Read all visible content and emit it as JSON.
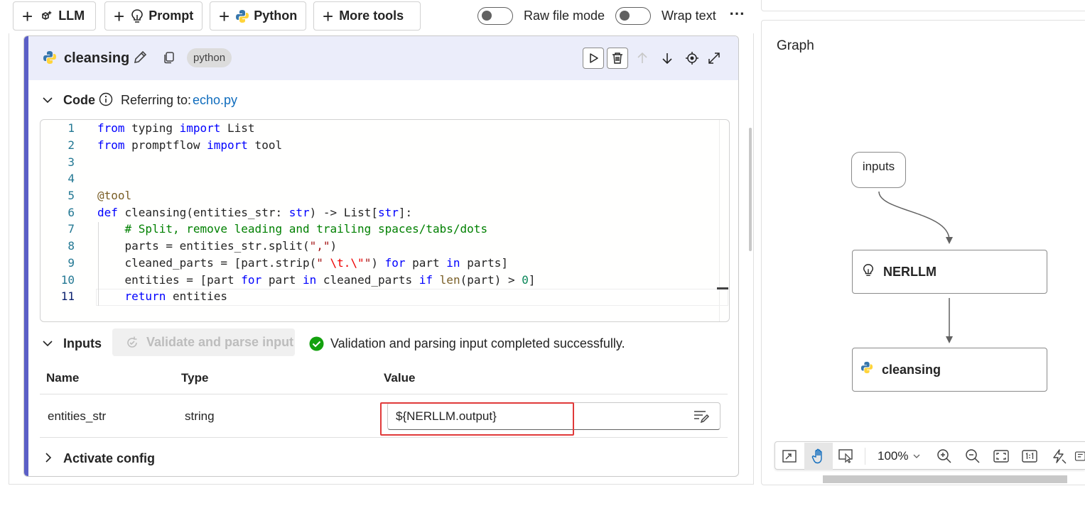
{
  "toolbar": {
    "llm_label": "LLM",
    "prompt_label": "Prompt",
    "python_label": "Python",
    "more_tools_label": "More tools",
    "raw_file_mode_label": "Raw file mode",
    "wrap_text_label": "Wrap text",
    "more_icon": "ellipsis-icon"
  },
  "node": {
    "name": "cleansing",
    "type_badge": "python",
    "actions": [
      "run-icon",
      "delete-icon",
      "arrow-up-icon",
      "arrow-down-icon",
      "locate-icon",
      "expand-icon"
    ]
  },
  "code_section": {
    "title": "Code",
    "referring_label": "Referring to:",
    "file_link": "echo.py",
    "lines": [
      {
        "n": "1"
      },
      {
        "n": "2"
      },
      {
        "n": "3"
      },
      {
        "n": "4"
      },
      {
        "n": "5"
      },
      {
        "n": "6"
      },
      {
        "n": "7"
      },
      {
        "n": "8"
      },
      {
        "n": "9"
      },
      {
        "n": "10"
      },
      {
        "n": "11"
      }
    ],
    "tokens": {
      "l1": [
        "from",
        " typing ",
        "import",
        " List"
      ],
      "l2": [
        "from",
        " promptflow ",
        "import",
        " tool"
      ],
      "l5": [
        "@tool"
      ],
      "l6": [
        "def",
        " cleansing(entities_str: ",
        "str",
        ") -> List[",
        "str",
        "]:"
      ],
      "l7": [
        "    ",
        "# Split, remove leading and trailing spaces/tabs/dots"
      ],
      "l8": [
        "    parts = entities_str.split(",
        "\",\"",
        ")"
      ],
      "l9": [
        "    cleaned_parts = [part.strip(",
        "\" ",
        "\\t.\\\"",
        "\"",
        ") ",
        "for",
        " part ",
        "in",
        " parts]"
      ],
      "l10": [
        "    entities = [part ",
        "for",
        " part ",
        "in",
        " cleaned_parts ",
        "if",
        " ",
        "len",
        "(part) > ",
        "0",
        "]"
      ],
      "l11": [
        "    ",
        "return",
        " entities"
      ]
    }
  },
  "inputs_section": {
    "title": "Inputs",
    "validate_button": "Validate and parse input",
    "status_text": "Validation and parsing input completed successfully.",
    "columns": [
      "Name",
      "Type",
      "Value"
    ],
    "rows": [
      {
        "name": "entities_str",
        "type": "string",
        "value": "${NERLLM.output}"
      }
    ]
  },
  "activate_config": {
    "title": "Activate config"
  },
  "graph": {
    "title": "Graph",
    "nodes": [
      {
        "label": "inputs"
      },
      {
        "label": "NERLLM",
        "icon": "lightbulb-icon"
      },
      {
        "label": "cleansing",
        "icon": "python-icon"
      }
    ],
    "zoom": "100%"
  },
  "colors": {
    "accent": "#5b5fc7",
    "link": "#0f6cbd",
    "success": "#13a10e",
    "highlight_box": "#e03a3a"
  }
}
